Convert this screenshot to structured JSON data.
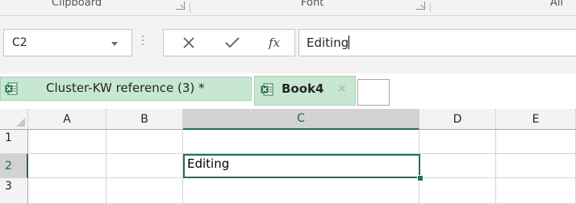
{
  "ribbon": {
    "groups": [
      "Clipboard",
      "Font",
      "Ali"
    ]
  },
  "formula_bar": {
    "name_box": "C2",
    "cancel_icon": "x-icon",
    "enter_icon": "checkmark-icon",
    "function_icon": "fx",
    "formula_value": "Editing"
  },
  "tabs": [
    {
      "label": "Cluster-KW reference (3) *",
      "icon": "excel-file-icon",
      "active": false
    },
    {
      "label": "Book4",
      "icon": "excel-file-icon",
      "active": true,
      "close": "×"
    }
  ],
  "grid": {
    "columns": [
      "A",
      "B",
      "C",
      "D",
      "E"
    ],
    "rows": [
      "1",
      "2",
      "3"
    ],
    "active_cell": "C2",
    "cells": {
      "C2": "Editing"
    }
  },
  "colors": {
    "excel_green": "#217346",
    "tab_bg": "#c7e7d2",
    "chrome_bg": "#f3f3f3"
  }
}
